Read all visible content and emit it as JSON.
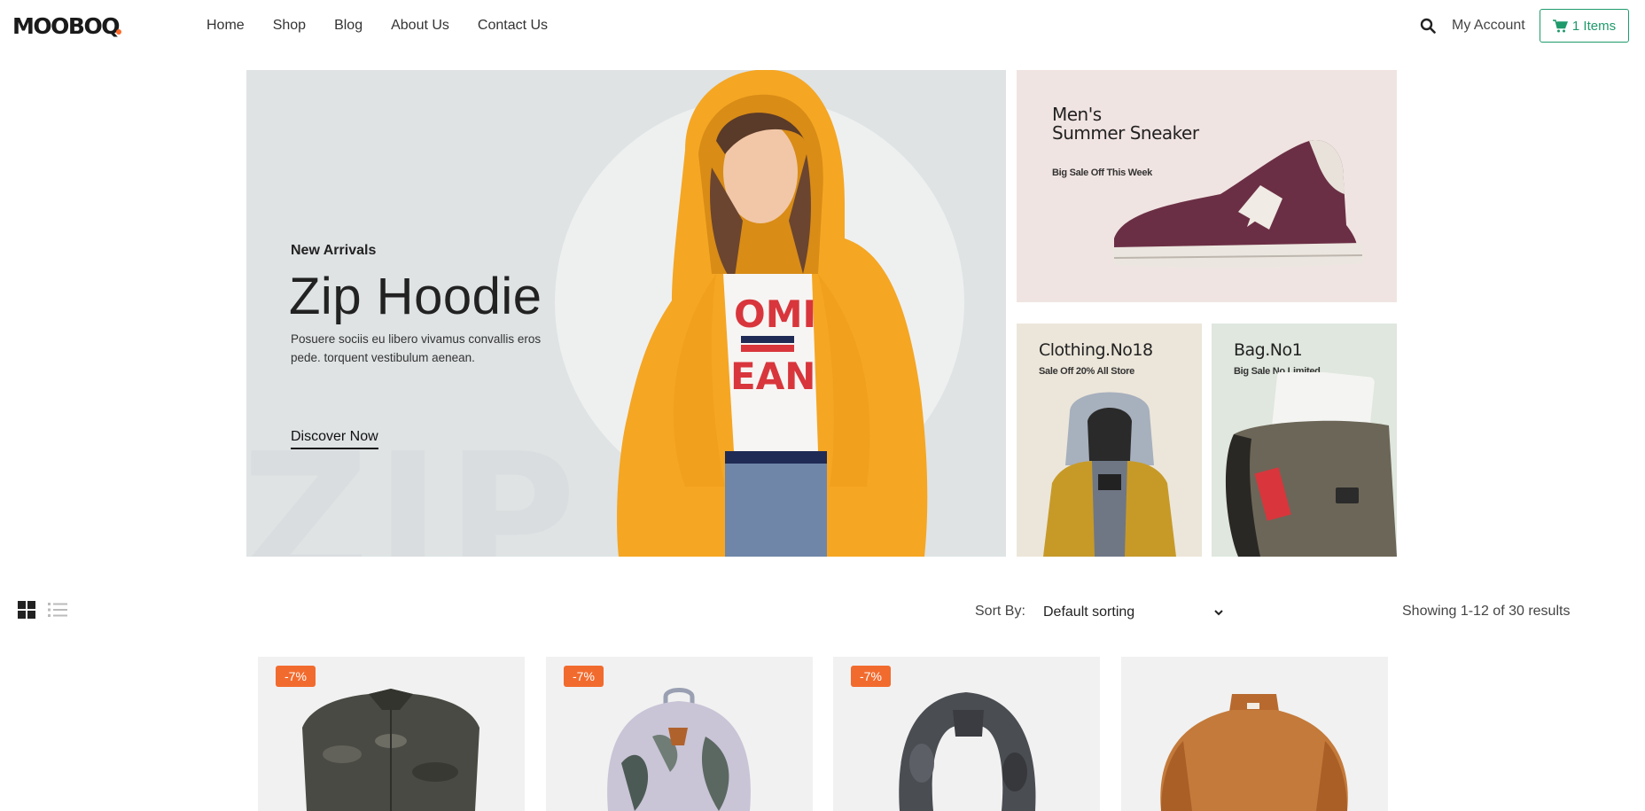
{
  "header": {
    "logo": "MOOBOQ",
    "nav": [
      "Home",
      "Shop",
      "Blog",
      "About Us",
      "Contact Us"
    ],
    "account": "My Account",
    "cart": "1 Items"
  },
  "hero": {
    "eyebrow": "New Arrivals",
    "title": "Zip Hoodie",
    "description": "Posuere sociis eu libero vivamus convallis eros pede. torquent vestibulum aenean.",
    "cta": "Discover Now",
    "background_word": "ZIP H"
  },
  "banners": [
    {
      "title_line1": "Men's",
      "title_line2": "Summer Sneaker",
      "subtitle": "Big Sale Off This Week"
    },
    {
      "title": "Clothing.No18",
      "subtitle": "Sale Off 20% All Store"
    },
    {
      "title": "Bag.No1",
      "subtitle": "Big Sale No Limited"
    }
  ],
  "toolbar": {
    "sort_label": "Sort By:",
    "sort_value": "Default sorting",
    "results": "Showing 1-12 of 30 results"
  },
  "products": [
    {
      "badge": "-7%",
      "image": "camo-shirt"
    },
    {
      "badge": "-7%",
      "image": "leaf-backpack"
    },
    {
      "badge": "-7%",
      "image": "camo-scarf"
    },
    {
      "badge": "",
      "image": "brown-sweater"
    }
  ],
  "colors": {
    "accent_green": "#1f9a6b",
    "badge_orange": "#f26b2e",
    "hoodie_yellow": "#f5a623"
  }
}
